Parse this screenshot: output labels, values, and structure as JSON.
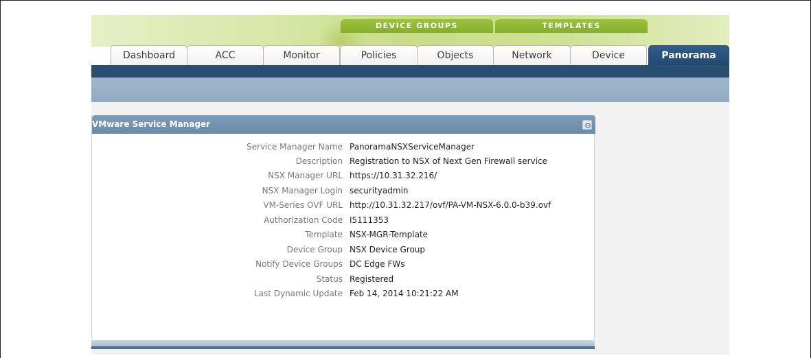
{
  "group_tabs": {
    "device_groups": "DEVICE GROUPS",
    "templates": "TEMPLATES"
  },
  "tabs": [
    {
      "label": "Dashboard"
    },
    {
      "label": "ACC"
    },
    {
      "label": "Monitor"
    },
    {
      "label": "Policies"
    },
    {
      "label": "Objects"
    },
    {
      "label": "Network"
    },
    {
      "label": "Device"
    },
    {
      "label": "Panorama",
      "active": true
    }
  ],
  "panel": {
    "title": "VMware Service Manager",
    "settings_icon": "gear-icon",
    "fields": [
      {
        "label": "Service Manager Name",
        "value": "PanoramaNSXServiceManager"
      },
      {
        "label": "Description",
        "value": "Registration to NSX of Next Gen Firewall service"
      },
      {
        "label": "NSX Manager URL",
        "value": "https://10.31.32.216/"
      },
      {
        "label": "NSX Manager Login",
        "value": "securityadmin"
      },
      {
        "label": "VM-Series OVF URL",
        "value": "http://10.31.32.217/ovf/PA-VM-NSX-6.0.0-b39.ovf"
      },
      {
        "label": "Authorization Code",
        "value": "I5111353"
      },
      {
        "label": "Template",
        "value": "NSX-MGR-Template"
      },
      {
        "label": "Device Group",
        "value": "NSX Device Group"
      },
      {
        "label": "Notify Device Groups",
        "value": "DC Edge FWs"
      },
      {
        "label": "Status",
        "value": "Registered"
      },
      {
        "label": "Last Dynamic Update",
        "value": "Feb 14, 2014 10:21:22 AM"
      }
    ]
  },
  "colors": {
    "nav_dark": "#2a4d72",
    "group_tab_green": "#8fb634",
    "panel_header": "#7392b1"
  }
}
